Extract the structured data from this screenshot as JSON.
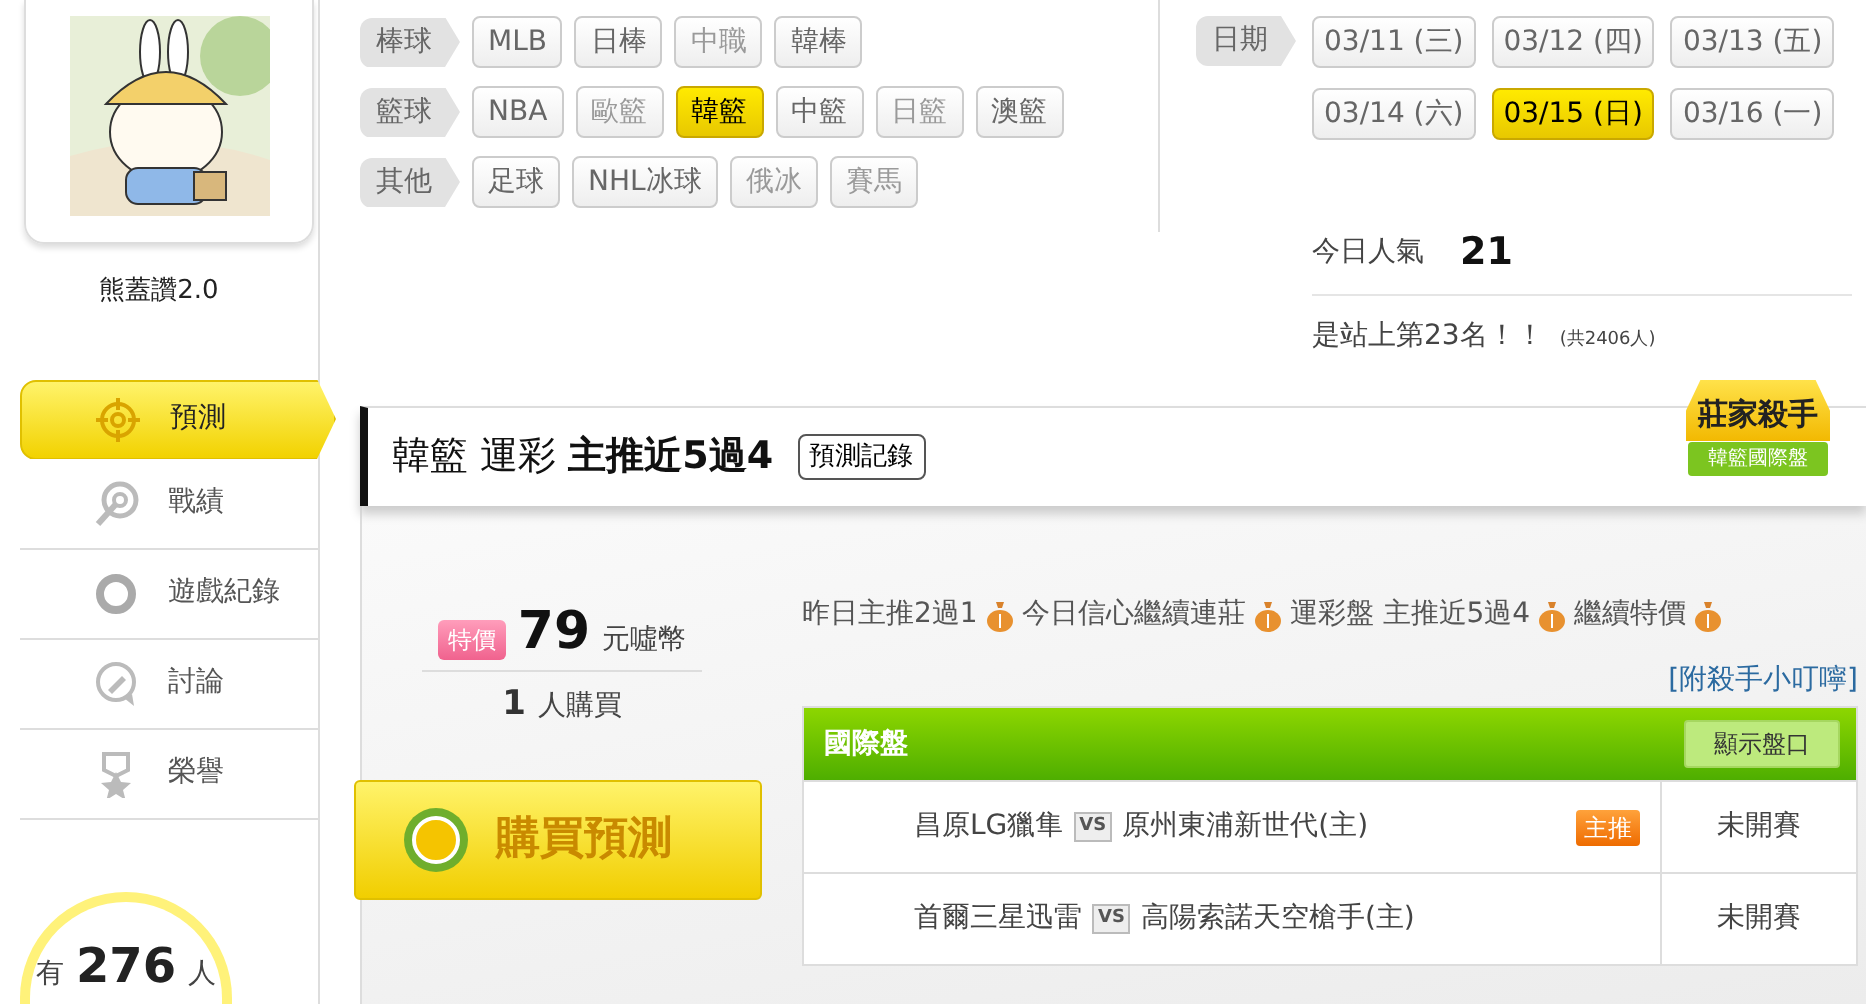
{
  "profile": {
    "username": "熊蓋讚2.0"
  },
  "nav": [
    {
      "label": "預測",
      "selected": true
    },
    {
      "label": "戰績",
      "selected": false
    },
    {
      "label": "遊戲紀錄",
      "selected": false
    },
    {
      "label": "討論",
      "selected": false
    },
    {
      "label": "榮譽",
      "selected": false
    }
  ],
  "online": {
    "prefix": "有",
    "count": "276",
    "suffix": "人"
  },
  "filters": [
    {
      "label": "棒球",
      "options": [
        {
          "label": "MLB",
          "selected": false,
          "disabled": false
        },
        {
          "label": "日棒",
          "selected": false,
          "disabled": false
        },
        {
          "label": "中職",
          "selected": false,
          "disabled": true
        },
        {
          "label": "韓棒",
          "selected": false,
          "disabled": false
        }
      ]
    },
    {
      "label": "籃球",
      "options": [
        {
          "label": "NBA",
          "selected": false,
          "disabled": false
        },
        {
          "label": "歐籃",
          "selected": false,
          "disabled": true
        },
        {
          "label": "韓籃",
          "selected": true,
          "disabled": false
        },
        {
          "label": "中籃",
          "selected": false,
          "disabled": false
        },
        {
          "label": "日籃",
          "selected": false,
          "disabled": true
        },
        {
          "label": "澳籃",
          "selected": false,
          "disabled": false
        }
      ]
    },
    {
      "label": "其他",
      "options": [
        {
          "label": "足球",
          "selected": false,
          "disabled": false
        },
        {
          "label": "NHL冰球",
          "selected": false,
          "disabled": false
        },
        {
          "label": "俄冰",
          "selected": false,
          "disabled": true
        },
        {
          "label": "賽馬",
          "selected": false,
          "disabled": true
        }
      ]
    }
  ],
  "dates": {
    "label": "日期",
    "options": [
      {
        "label": "03/11 (三)",
        "selected": false
      },
      {
        "label": "03/12 (四)",
        "selected": false
      },
      {
        "label": "03/13 (五)",
        "selected": false
      },
      {
        "label": "03/14 (六)",
        "selected": false
      },
      {
        "label": "03/15 (日)",
        "selected": true
      },
      {
        "label": "03/16 (一)",
        "selected": false
      }
    ]
  },
  "popularity": {
    "label": "今日人氣",
    "value": "21",
    "rank": "是站上第23名！！",
    "total": "(共2406人)"
  },
  "header": {
    "title": "韓籃 運彩 **主推近5過4**",
    "record_button": "預測記錄",
    "badge_title": "莊家殺手",
    "badge_subtitle": "韓籃國際盤"
  },
  "offer": {
    "tag": "特價",
    "price": "79",
    "unit": "元噓幣",
    "buyers": "1",
    "buyers_label": "人購買",
    "buy_button": "購買預測"
  },
  "message": [
    "昨日主推2過1",
    "今日信心繼續連莊",
    "運彩盤 主推近5過4",
    "繼續特價"
  ],
  "tips_link": "[附殺手小叮嚀]",
  "table": {
    "title": "國際盤",
    "show_button": "顯示盤口",
    "rows": [
      {
        "away": "昌原LG獵隼",
        "vs": "VS",
        "home": "原州東浦新世代(主)",
        "featured_label": "主推",
        "status": "未開賽"
      },
      {
        "away": "首爾三星迅雷",
        "vs": "VS",
        "home": "高陽索諾天空槍手(主)",
        "status": "未開賽"
      }
    ]
  }
}
